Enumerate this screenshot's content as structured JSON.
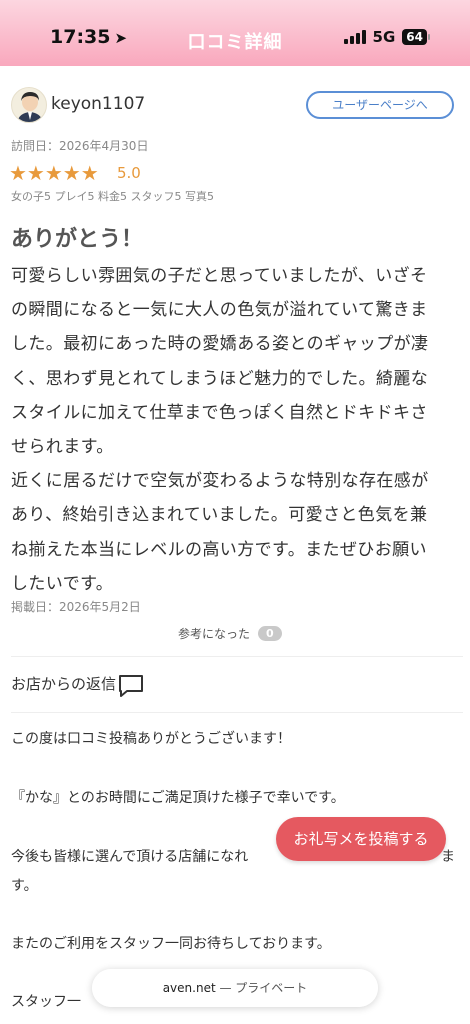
{
  "status_bar": {
    "time": "17:35",
    "network": "5G",
    "battery": "64"
  },
  "header": {
    "title": "口コミ詳細"
  },
  "reviewer": {
    "username": "keyon1107",
    "user_page_button": "ユーザーページへ"
  },
  "review": {
    "visit_date": "訪問日：2026年4月30日",
    "star_count": 5,
    "stars": "★★★★★",
    "rating": "5.0",
    "sub_ratings": "女の子5 プレイ5 料金5 スタッフ5 写真5",
    "title": "ありがとう！",
    "body_lines": [
      "可愛らしい雰囲気の子だと思っていましたが、いざそ",
      "の瞬間になると一気に大人の色気が溢れていて驚きま",
      "した。最初にあった時の愛嬌ある姿とのギャップが凄",
      "く、思わず見とれてしまうほど魅力的でした。綺麗な",
      "スタイルに加えて仕草まで色っぽく自然とドキドキさ",
      "せられます。",
      "近くに居るだけで空気が変わるような特別な存在感が",
      "あり、終始引き込まれていました。可愛さと色気を兼",
      "ね揃えた本当にレベルの高い方です。またぜひお願い",
      "したいです。"
    ],
    "post_date": "掲載日：2026年5月2日",
    "helpful_label": "参考になった",
    "helpful_count": "0"
  },
  "reply": {
    "heading": "お店からの返信",
    "lines": [
      "この度は口コミ投稿ありがとうございます！",
      "",
      "『かな』とのお時間にご満足頂けた様子で幸いです。",
      "",
      "今後も皆様に選んで頂ける店舗になれ",
      "す。",
      "",
      "またのご利用をスタッフ一同お待ちしております。",
      "",
      "スタッフ一"
    ],
    "line_tail_partial": "ま"
  },
  "floating_button": {
    "label": "お礼写メを投稿する"
  },
  "browser_bar": {
    "domain": "aven.net",
    "mode": " — プライベート"
  }
}
